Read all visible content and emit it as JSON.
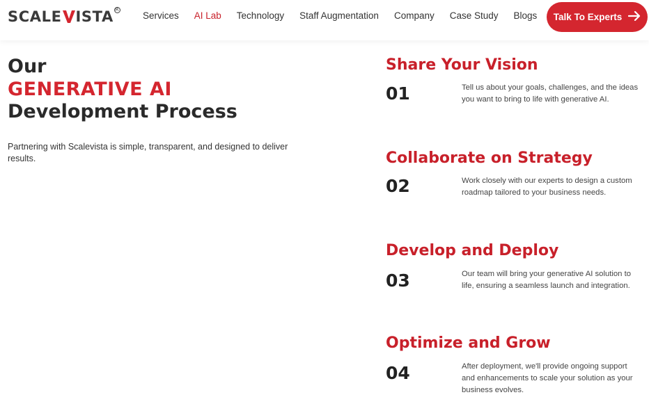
{
  "header": {
    "logo_text_left": "SCALE",
    "logo_text_right": "ISTA",
    "nav": [
      {
        "label": "Services"
      },
      {
        "label": "AI Lab"
      },
      {
        "label": "Technology"
      },
      {
        "label": "Staff Augmentation"
      },
      {
        "label": "Company"
      },
      {
        "label": "Case Study"
      },
      {
        "label": "Blogs"
      }
    ],
    "active_nav": "AI Lab",
    "cta_label": "Talk To Experts",
    "cta_icon": "arrow-right-icon"
  },
  "hero": {
    "line1": "Our",
    "line2": "GENERATIVE AI",
    "line3": "Development Process",
    "intro": "Partnering with Scalevista is simple, transparent, and designed to deliver results."
  },
  "steps": [
    {
      "title": "Share Your Vision",
      "number": "01",
      "description": "Tell us about your goals, challenges, and the ideas you want to bring to life with generative AI."
    },
    {
      "title": "Collaborate on Strategy",
      "number": "02",
      "description": "Work closely with our experts to design a custom roadmap tailored to your business needs."
    },
    {
      "title": "Develop and Deploy",
      "number": "03",
      "description": "Our team will bring your generative AI solution to life, ensuring a seamless launch and integration."
    },
    {
      "title": "Optimize and Grow",
      "number": "04",
      "description": "After deployment, we'll provide ongoing support and enhancements to scale your solution as your business evolves."
    }
  ],
  "colors": {
    "accent": "#d4262f",
    "text_dark": "#2a2a2a",
    "text_body": "#444444"
  }
}
